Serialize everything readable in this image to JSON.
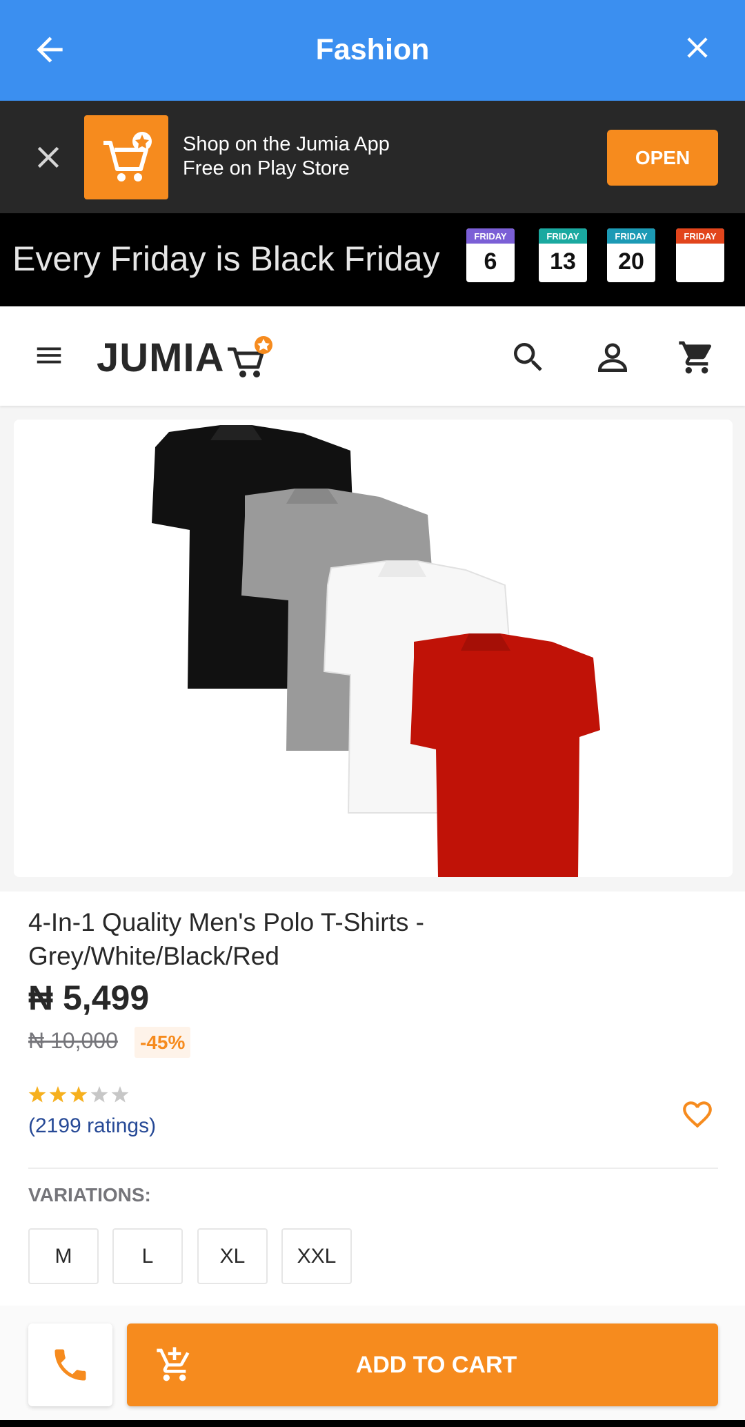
{
  "appbar": {
    "title": "Fashion",
    "back_icon": "arrow-back-icon",
    "close_icon": "close-icon",
    "color": "#3b8ff0"
  },
  "promo": {
    "line1": "Shop on the Jumia App",
    "line2": "Free on Play Store",
    "open_label": "OPEN",
    "accent": "#f68b1e"
  },
  "banner": {
    "text": "Every Friday is Black Friday",
    "calendars": [
      {
        "header": "FRIDAY",
        "day": "6",
        "color": "#7b5fd6"
      },
      {
        "header": "FRIDAY",
        "day": "13",
        "color": "#1aa9a0"
      },
      {
        "header": "FRIDAY",
        "day": "20",
        "color": "#1c9ab5"
      },
      {
        "header": "FRIDAY",
        "day": "",
        "color": "#e2451c"
      }
    ]
  },
  "header": {
    "logo": "JUMIA"
  },
  "product": {
    "title": "4-In-1 Quality Men's Polo T-Shirts - Grey/White/Black/Red",
    "price": "₦ 5,499",
    "old_price": "₦ 10,000",
    "discount": "-45%",
    "rating_stars": 3,
    "rating_max": 5,
    "ratings_text": "(2199 ratings)",
    "variations_label": "VARIATIONS:",
    "variations": [
      "M",
      "L",
      "XL",
      "XXL"
    ]
  },
  "bottom": {
    "add_to_cart": "ADD TO CART"
  }
}
